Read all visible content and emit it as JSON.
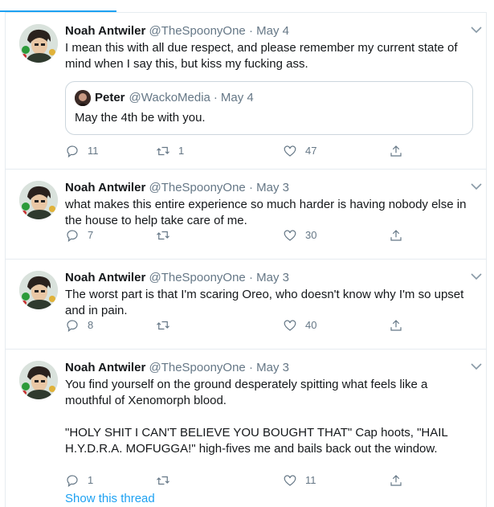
{
  "tweets": [
    {
      "name": "Noah Antwiler",
      "handle": "@TheSpoonyOne",
      "date": "May 4",
      "text": "I mean this with all due respect, and please remember my current state of mind when I say this, but kiss my fucking ass.",
      "quote": {
        "name": "Peter",
        "handle": "@WackoMedia",
        "date": "May 4",
        "text": "May the 4th be with you."
      },
      "replies": "11",
      "retweets": "1",
      "likes": "47"
    },
    {
      "name": "Noah Antwiler",
      "handle": "@TheSpoonyOne",
      "date": "May 3",
      "text": "what makes this entire experience so much harder is having nobody else in the house to help take care of me.",
      "replies": "7",
      "retweets": "",
      "likes": "30"
    },
    {
      "name": "Noah Antwiler",
      "handle": "@TheSpoonyOne",
      "date": "May 3",
      "text": "The worst part is that I'm scaring Oreo, who doesn't know why I'm so upset and in pain.",
      "replies": "8",
      "retweets": "",
      "likes": "40"
    },
    {
      "name": "Noah Antwiler",
      "handle": "@TheSpoonyOne",
      "date": "May 3",
      "text": "You find yourself on the ground desperately spitting what feels like a mouthful of Xenomorph blood.\n\n\"HOLY SHIT I CAN'T BELIEVE YOU BOUGHT THAT\" Cap hoots, \"HAIL H.Y.D.R.A. MOFUGGA!\" high-fives me and bails back out the window.",
      "replies": "1",
      "retweets": "",
      "likes": "11"
    }
  ],
  "show_thread_label": "Show this thread",
  "separator": "·",
  "icons": {
    "reply": "reply-icon",
    "retweet": "retweet-icon",
    "like": "heart-icon",
    "share": "share-icon",
    "caret": "chevron-down-icon"
  },
  "colors": {
    "accent": "#1da1f2",
    "secondary_text": "#657786",
    "border": "#e6ecf0"
  }
}
